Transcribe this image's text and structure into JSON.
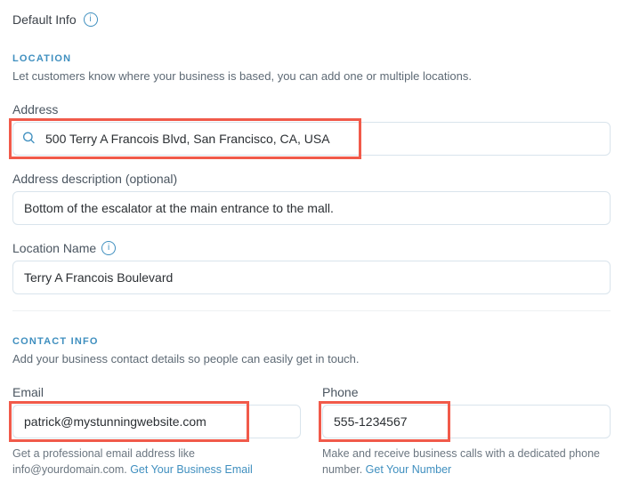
{
  "header": {
    "default_info_label": "Default Info"
  },
  "location": {
    "section_title": "LOCATION",
    "section_sub": "Let customers know where your business is based, you can add one or multiple locations.",
    "address_label": "Address",
    "address_value": "500 Terry A Francois Blvd, San Francisco, CA, USA",
    "desc_label": "Address description (optional)",
    "desc_value": "Bottom of the escalator at the main entrance to the mall.",
    "name_label": "Location Name",
    "name_value": "Terry A Francois Boulevard"
  },
  "contact": {
    "section_title": "CONTACT INFO",
    "section_sub": "Add your business contact details so people can easily get in touch.",
    "email_label": "Email",
    "email_value": "patrick@mystunningwebsite.com",
    "email_help_pre": "Get a professional email address like info@yourdomain.com. ",
    "email_help_link": "Get Your Business Email",
    "phone_label": "Phone",
    "phone_value": "555-1234567",
    "phone_help_pre": "Make and receive business calls with a dedicated phone number. ",
    "phone_help_link": "Get Your Number"
  },
  "icons": {
    "info": "i",
    "search": "search"
  }
}
